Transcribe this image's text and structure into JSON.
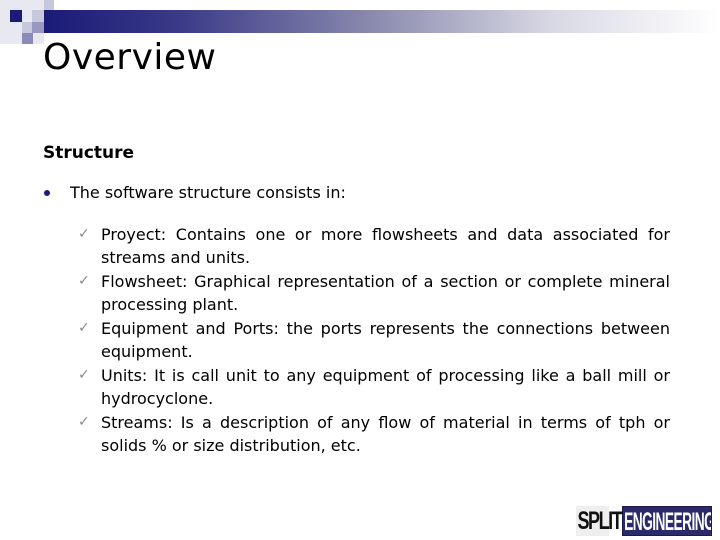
{
  "slide": {
    "title": "Overview",
    "section_heading": "Structure",
    "bullet": "The software structure consists in:",
    "sub_items": [
      "Proyect: Contains one or more flowsheets and data associated for streams and units.",
      "Flowsheet: Graphical representation of a section or complete mineral processing plant.",
      "Equipment and Ports: the ports represents the connections between equipment.",
      "Units: It is call unit to any equipment of processing like a ball mill or hydrocyclone.",
      "Streams: Is a description of any flow of material in terms of tph or solids % or size distribution, etc."
    ],
    "check_icon": "✓"
  },
  "logo": {
    "part1": "SPLIT",
    "part2": "ENGINEERING"
  },
  "colors": {
    "accent": "#1a1a78",
    "check": "#8a8a8a"
  }
}
